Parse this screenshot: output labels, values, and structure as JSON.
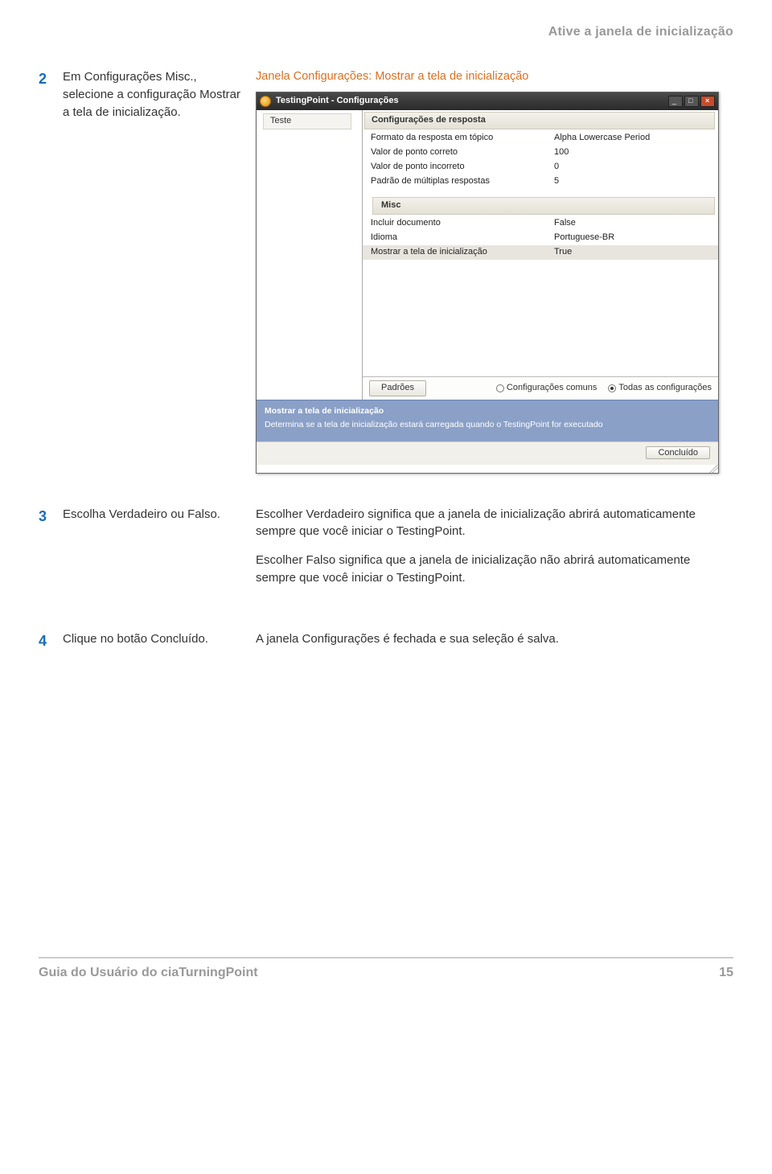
{
  "header": {
    "running_title": "Ative a janela de inicialização"
  },
  "steps": {
    "s2": {
      "num": "2",
      "left": "Em Configurações Misc., selecione a configuração Mostrar a tela de inicialização.",
      "caption": "Janela Configurações: Mostrar a tela de inicialização"
    },
    "s3": {
      "num": "3",
      "left": "Escolha Verdadeiro ou Falso.",
      "p1": "Escolher Verdadeiro significa que a janela de inicialização abrirá automaticamente sempre que você iniciar o TestingPoint.",
      "p2": "Escolher Falso significa que a janela de inicialização não abrirá automaticamente sempre que você iniciar o TestingPoint."
    },
    "s4": {
      "num": "4",
      "left": "Clique no botão Concluído.",
      "right": "A janela Configurações é fechada e sua seleção é salva."
    }
  },
  "app": {
    "title": "TestingPoint - Configurações",
    "tree_root": "Teste",
    "group1": "Configurações de resposta",
    "rows1": [
      {
        "k": "Formato da resposta em tópico",
        "v": "Alpha Lowercase Period"
      },
      {
        "k": "Valor de ponto correto",
        "v": "100"
      },
      {
        "k": "Valor de ponto incorreto",
        "v": "0"
      },
      {
        "k": "Padrão de múltiplas respostas",
        "v": "5"
      }
    ],
    "group2": "Misc",
    "rows2": [
      {
        "k": "Incluir documento",
        "v": "False"
      },
      {
        "k": "Idioma",
        "v": "Portuguese-BR"
      },
      {
        "k": "Mostrar a tela de inicialização",
        "v": "True",
        "selected": true
      }
    ],
    "btn_padroes": "Padrões",
    "radio_comuns": "Configurações comuns",
    "radio_todas": "Todas as configurações",
    "help_title": "Mostrar a tela de inicialização",
    "help_text": "Determina se a tela de inicialização estará carregada quando o TestingPoint for executado",
    "btn_concluido": "Concluído"
  },
  "footer": {
    "left": "Guia do Usuário do ciaTurningPoint",
    "right": "15"
  }
}
